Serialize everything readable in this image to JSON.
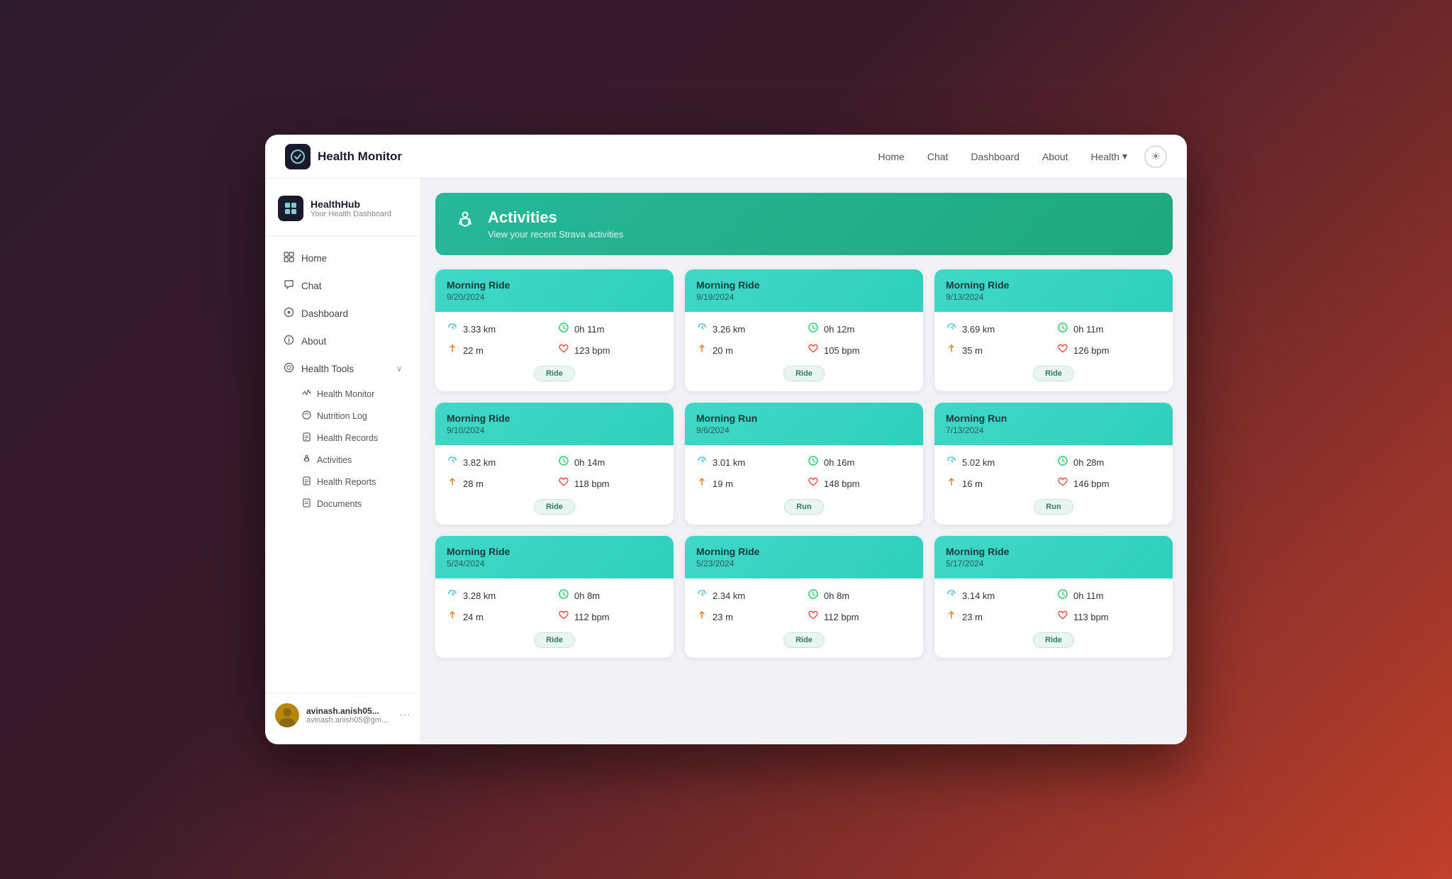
{
  "topNav": {
    "logo_icon": "⚕",
    "logo_text": "Health Monitor",
    "links": [
      "Home",
      "Chat",
      "Dashboard",
      "About"
    ],
    "health_link": "Health",
    "sun_icon": "☀"
  },
  "sidebar": {
    "brand_icon": "⌘",
    "brand_name": "HealthHub",
    "brand_sub": "Your Health Dashboard",
    "nav_items": [
      {
        "icon": "⌘",
        "label": "Home"
      },
      {
        "icon": "✈",
        "label": "Chat"
      },
      {
        "icon": "👤",
        "label": "Dashboard"
      },
      {
        "icon": "◎",
        "label": "About"
      }
    ],
    "health_tools_label": "Health Tools",
    "health_tools_icon": "⚙",
    "chevron": "∨",
    "submenu": [
      {
        "icon": "⚡",
        "label": "Health Monitor"
      },
      {
        "icon": "🍎",
        "label": "Nutrition Log"
      },
      {
        "icon": "📄",
        "label": "Health Records"
      },
      {
        "icon": "🏃",
        "label": "Activities"
      },
      {
        "icon": "📊",
        "label": "Health Reports"
      },
      {
        "icon": "📋",
        "label": "Documents"
      }
    ],
    "user_name": "avinash.anish05...",
    "user_email": "avinash.anish05@gm...",
    "more_icon": "···"
  },
  "activitiesBanner": {
    "icon": "🏃",
    "title": "Activities",
    "subtitle": "View your recent Strava activities"
  },
  "activities": [
    {
      "title": "Morning Ride",
      "date": "9/20/2024",
      "distance": "3.33 km",
      "time": "0h 11m",
      "elevation": "22 m",
      "bpm": "123 bpm",
      "type": "Ride"
    },
    {
      "title": "Morning Ride",
      "date": "9/19/2024",
      "distance": "3.26 km",
      "time": "0h 12m",
      "elevation": "20 m",
      "bpm": "105 bpm",
      "type": "Ride"
    },
    {
      "title": "Morning Ride",
      "date": "9/13/2024",
      "distance": "3.69 km",
      "time": "0h 11m",
      "elevation": "35 m",
      "bpm": "126 bpm",
      "type": "Ride"
    },
    {
      "title": "Morning Ride",
      "date": "9/10/2024",
      "distance": "3.82 km",
      "time": "0h 14m",
      "elevation": "28 m",
      "bpm": "118 bpm",
      "type": "Ride"
    },
    {
      "title": "Morning Run",
      "date": "9/6/2024",
      "distance": "3.01 km",
      "time": "0h 16m",
      "elevation": "19 m",
      "bpm": "148 bpm",
      "type": "Run"
    },
    {
      "title": "Morning Run",
      "date": "7/13/2024",
      "distance": "5.02 km",
      "time": "0h 28m",
      "elevation": "16 m",
      "bpm": "146 bpm",
      "type": "Run"
    },
    {
      "title": "Morning Ride",
      "date": "5/24/2024",
      "distance": "3.28 km",
      "time": "0h 8m",
      "elevation": "24 m",
      "bpm": "112 bpm",
      "type": "Ride"
    },
    {
      "title": "Morning Ride",
      "date": "5/23/2024",
      "distance": "2.34 km",
      "time": "0h 8m",
      "elevation": "23 m",
      "bpm": "112 bpm",
      "type": "Ride"
    },
    {
      "title": "Morning Ride",
      "date": "5/17/2024",
      "distance": "3.14 km",
      "time": "0h 11m",
      "elevation": "23 m",
      "bpm": "113 bpm",
      "type": "Ride"
    }
  ]
}
